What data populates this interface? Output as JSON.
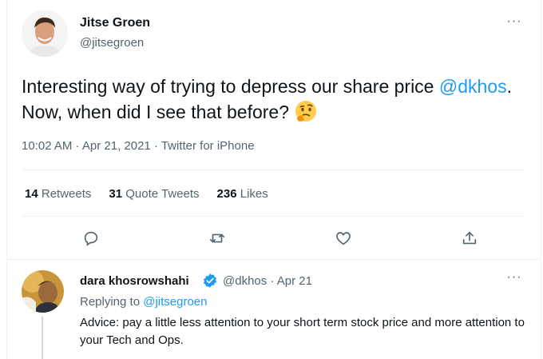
{
  "tweet": {
    "author_name": "Jitse Groen",
    "author_handle": "@jitsegroen",
    "more_label": "···",
    "text_before": "Interesting way of trying to depress our share price ",
    "mention": "@dkhos",
    "text_after": ". Now, when did I see that before? ",
    "emoji": "thinking-face",
    "meta": "10:02 AM · Apr 21, 2021 · Twitter for iPhone",
    "stats": {
      "retweets_count": "14",
      "retweets_label": "Retweets",
      "quotes_count": "31",
      "quotes_label": "Quote Tweets",
      "likes_count": "236",
      "likes_label": "Likes"
    },
    "actions": [
      "reply-icon",
      "retweet-icon",
      "like-icon",
      "share-icon"
    ]
  },
  "reply": {
    "author_name": "dara khosrowshahi",
    "author_handle_date": "@dkhos · Apr 21",
    "more_label": "···",
    "replying_prefix": "Replying to ",
    "replying_handle": "@jitsegroen",
    "text": "Advice:  pay a little less attention to your short term stock price and more attention to your Tech and Ops."
  },
  "colors": {
    "accent": "#1d9bf0",
    "text": "#0f1419",
    "muted": "#536471",
    "divider": "#eff3f4"
  }
}
